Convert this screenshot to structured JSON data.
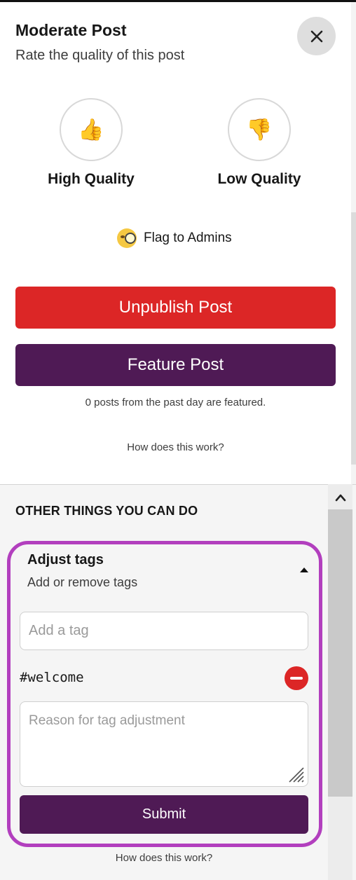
{
  "header": {
    "title": "Moderate Post",
    "subtitle": "Rate the quality of this post"
  },
  "rating": {
    "high_label": "High Quality",
    "high_icon": "👍",
    "low_label": "Low Quality",
    "low_icon": "👎"
  },
  "flag": {
    "label": "Flag to Admins"
  },
  "actions": {
    "unpublish_label": "Unpublish Post",
    "feature_label": "Feature Post",
    "featured_note": "0 posts from the past day are featured.",
    "help_link": "How does this work?"
  },
  "other": {
    "section_title": "OTHER THINGS YOU CAN DO",
    "adjust_tags": {
      "title": "Adjust tags",
      "subtitle": "Add or remove tags",
      "tag_input_placeholder": "Add a tag",
      "tags": [
        "#welcome"
      ],
      "reason_placeholder": "Reason for tag adjustment",
      "submit_label": "Submit"
    },
    "help_link": "How does this work?"
  },
  "colors": {
    "danger": "#dc2626",
    "brand": "#4f1a55",
    "highlight": "#b23fbe"
  }
}
